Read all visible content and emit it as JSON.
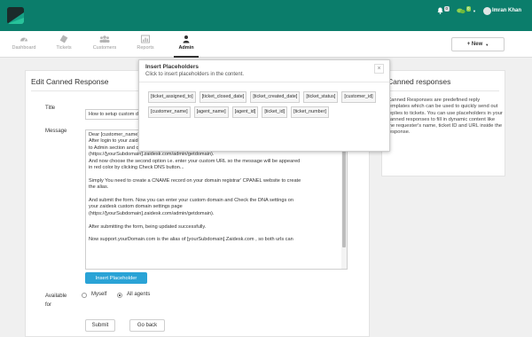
{
  "topbar": {
    "logo": "app-logo",
    "notifications_icon": "bell-icon",
    "notifications_count": "0",
    "chat_icon": "chat-bubbles-icon",
    "chat_count": "0",
    "user_name": "Imran Khan",
    "colors": {
      "bar": "#0b7d6b",
      "badge_green": "#8fd14f"
    }
  },
  "nav": {
    "items": [
      {
        "label": "Dashboard",
        "icon": "dashboard-icon"
      },
      {
        "label": "Tickets",
        "icon": "ticket-icon"
      },
      {
        "label": "Customers",
        "icon": "users-icon"
      },
      {
        "label": "Reports",
        "icon": "bar-chart-icon"
      },
      {
        "label": "Admin",
        "icon": "user-icon",
        "active": true
      }
    ],
    "new_button": "+ New"
  },
  "form": {
    "heading": "Edit Canned Response",
    "title_label": "Title",
    "title_value": "How to setup custom domain",
    "message_label": "Message",
    "message_lines": [
      "Dear [customer_name],",
      "After login to your zaidesk account, follow these instructions: go",
      "to Admin section and click on Domain Settings",
      "(https://[yourSubdomain].zaidesk.com/admin/getdomain).",
      "And now choose the second option i.e. enter your custom URL so the message will be appeared",
      "in red color by clicking Check DNS button...",
      "",
      "Simply You need to create a CNAME record on your domain registrar' CPANEL website to create",
      "the alias.",
      "",
      "And submit the form. Now you can enter your custom domain and Check the DNA settings on",
      "your zaidesk custom domain settings page",
      "(https://[yourSubdomain].zaidesk.com/admin/getdomain).",
      "",
      "After submitting the form, being updated successfully.",
      "",
      "Now support.yourDomain.com is the alias of [yourSubdomain].Zaidesk.com , so both urls can"
    ],
    "insert_button": "Insert Placeholder",
    "available_label": "Available for",
    "option_myself": "Myself",
    "option_all": "All agents",
    "selected_option": "All agents",
    "submit_button": "Submit",
    "back_button": "Go back",
    "accent_color": "#2aa3d6"
  },
  "sidebar": {
    "heading": "Canned responses",
    "body": "Canned Responses are predefined reply templates which can be used to quickly send out replies to tickets. You can use placeholders in your canned responses to fill in dynamic content like the requester's name, ticket ID and URL inside the response."
  },
  "popover": {
    "title": "Insert Placeholders",
    "subtitle": "Click to insert placeholders in the content.",
    "close": "×",
    "placeholders": [
      "[ticket_assigned_to]",
      "[ticket_closed_date]",
      "[ticket_created_date]",
      "[ticket_status]",
      "[customer_id]",
      "[customer_name]",
      "[agent_name]",
      "[agent_id]",
      "[ticket_id]",
      "[ticket_number]"
    ]
  }
}
